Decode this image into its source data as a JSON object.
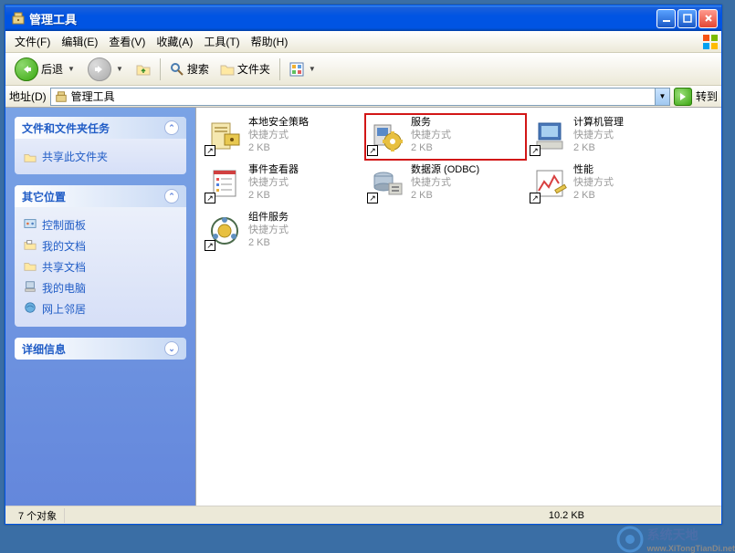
{
  "window": {
    "title": "管理工具"
  },
  "menu": {
    "file": "文件(F)",
    "edit": "编辑(E)",
    "view": "查看(V)",
    "favorites": "收藏(A)",
    "tools": "工具(T)",
    "help": "帮助(H)"
  },
  "toolbar": {
    "back": "后退",
    "search": "搜索",
    "folders": "文件夹"
  },
  "address": {
    "label": "地址(D)",
    "value": "管理工具",
    "go": "转到"
  },
  "sidebar": {
    "tasks": {
      "title": "文件和文件夹任务",
      "share": "共享此文件夹"
    },
    "other": {
      "title": "其它位置",
      "items": [
        "控制面板",
        "我的文档",
        "共享文档",
        "我的电脑",
        "网上邻居"
      ]
    },
    "details": {
      "title": "详细信息"
    }
  },
  "shortcut_type": "快捷方式",
  "shortcut_size": "2 KB",
  "files": [
    {
      "name": "本地安全策略",
      "highlight": false
    },
    {
      "name": "服务",
      "highlight": true
    },
    {
      "name": "计算机管理",
      "highlight": false
    },
    {
      "name": "事件查看器",
      "highlight": false
    },
    {
      "name": "数据源 (ODBC)",
      "highlight": false
    },
    {
      "name": "性能",
      "highlight": false
    },
    {
      "name": "组件服务",
      "highlight": false
    }
  ],
  "status": {
    "objects": "7 个对象",
    "size": "10.2 KB"
  },
  "watermark": {
    "brand": "系统天地",
    "url": "www.XiTongTianDi.net"
  }
}
